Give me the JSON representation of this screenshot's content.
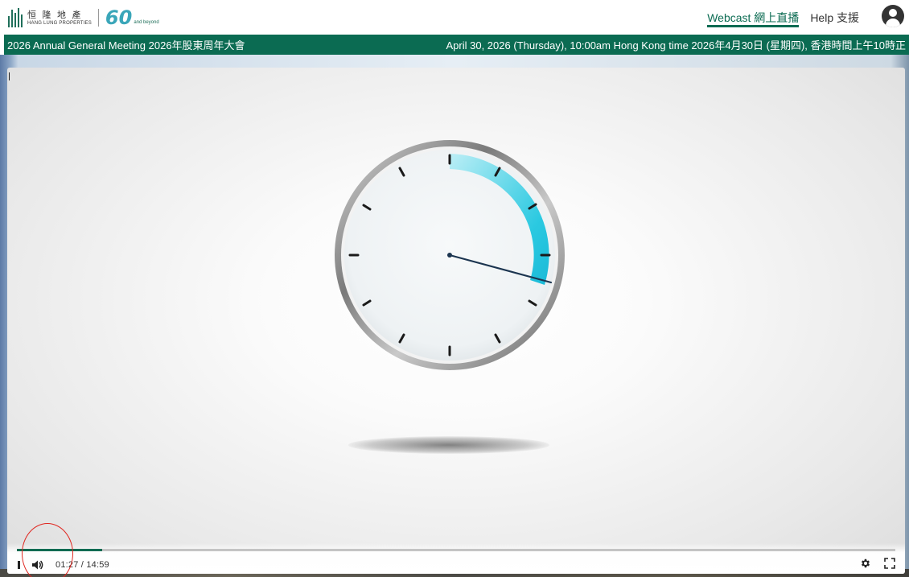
{
  "header": {
    "logo": {
      "brand_cn": "恒 隆 地 產",
      "brand_en": "HANG LUNG PROPERTIES",
      "anniversary_number": "60",
      "anniversary_sub": "and beyond"
    },
    "nav": [
      {
        "label": "Webcast 網上直播",
        "active": true
      },
      {
        "label": "Help 支援",
        "active": false
      }
    ],
    "account_icon": "account-circle-icon"
  },
  "band": {
    "event_title": "2026 Annual General Meeting 2026年股東周年大會",
    "event_datetime": "April 30, 2026 (Thursday), 10:00am Hong Kong time 2026年4月30日 (星期四), 香港時間上午10時正"
  },
  "player": {
    "current_time": "01:27",
    "separator": " / ",
    "duration": "14:59",
    "progress_fraction": 0.097,
    "icons": {
      "pause": "pause-icon",
      "volume": "volume-icon",
      "settings": "gear-icon",
      "fullscreen": "fullscreen-icon"
    }
  },
  "colors": {
    "brand_green": "#0b6b52",
    "clock_accent": "#1ec8de",
    "annotation": "#e0261f"
  }
}
